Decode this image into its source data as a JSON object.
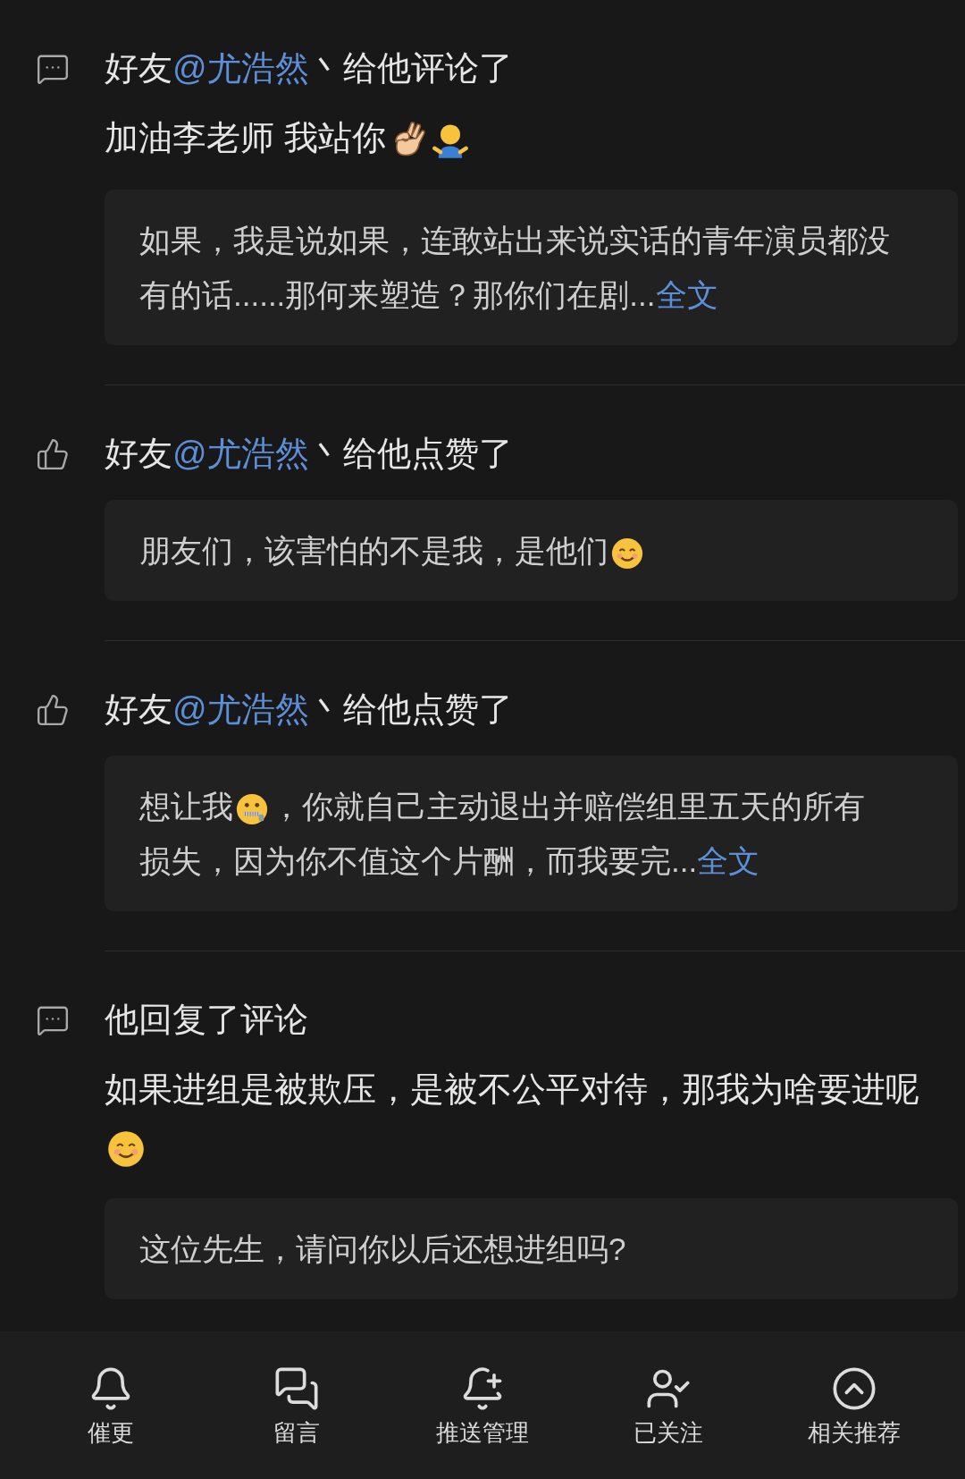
{
  "feed": [
    {
      "kind": "comment",
      "prefix": "好友",
      "mention": "@尤浩然",
      "action": "丶给他评论了",
      "content": [
        {
          "kind": "text",
          "text": "加油李老师 我站你"
        },
        {
          "kind": "ok-hand"
        },
        {
          "kind": "figure"
        }
      ],
      "quote": {
        "segments": [
          {
            "kind": "text",
            "text": "如果，我是说如果，连敢站出来说实话的青年演员都没有的话......那何来塑造？那你们在剧..."
          }
        ],
        "more": "全文"
      }
    },
    {
      "kind": "like",
      "prefix": "好友",
      "mention": "@尤浩然",
      "action": "丶给他点赞了",
      "quote": {
        "segments": [
          {
            "kind": "text",
            "text": "朋友们，该害怕的不是我，是他们"
          },
          {
            "kind": "smile"
          }
        ]
      }
    },
    {
      "kind": "like",
      "prefix": "好友",
      "mention": "@尤浩然",
      "action": "丶给他点赞了",
      "quote": {
        "segments": [
          {
            "kind": "text",
            "text": "想让我"
          },
          {
            "kind": "zipper"
          },
          {
            "kind": "text",
            "text": "，你就自己主动退出并赔偿组里五天的所有损失，因为你不值这个片酬，而我要完..."
          }
        ],
        "more": "全文"
      }
    },
    {
      "kind": "comment",
      "action": "他回复了评论",
      "content": [
        {
          "kind": "text",
          "text": "如果进组是被欺压，是被不公平对待，那我为啥要进呢"
        },
        {
          "kind": "smile"
        }
      ],
      "quote": {
        "segments": [
          {
            "kind": "text",
            "text": "这位先生，请问你以后还想进组吗?"
          }
        ]
      }
    }
  ],
  "bottom_bar": [
    {
      "kind": "bell",
      "label": "催更"
    },
    {
      "kind": "messages",
      "label": "留言"
    },
    {
      "kind": "bell-plus",
      "label": "推送管理"
    },
    {
      "kind": "user-check",
      "label": "已关注"
    },
    {
      "kind": "circle-up",
      "label": "相关推荐"
    }
  ]
}
